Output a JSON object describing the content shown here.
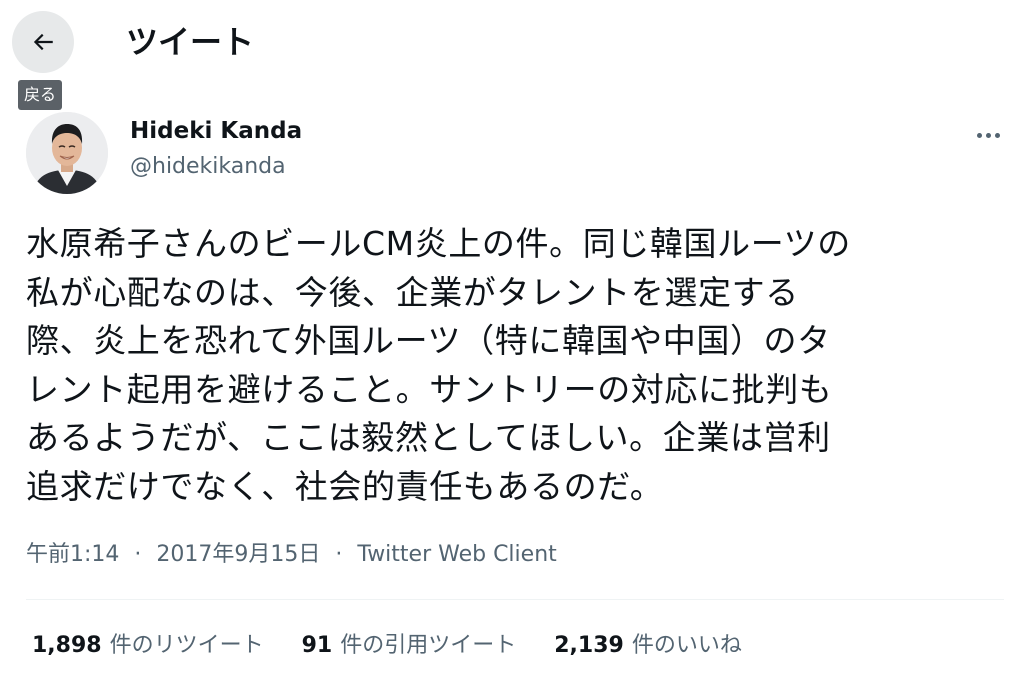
{
  "header": {
    "back_tooltip": "戻る",
    "title": "ツイート"
  },
  "author": {
    "name": "Hideki Kanda",
    "handle": "@hidekikanda"
  },
  "tweet": {
    "lines": [
      "水原希子さんのビールCM炎上の件。同じ韓国ルーツの",
      "私が心配なのは、今後、企業がタレントを選定する",
      "際、炎上を恐れて外国ルーツ（特に韓国や中国）のタ",
      "レント起用を避けること。サントリーの対応に批判も",
      "あるようだが、ここは毅然としてほしい。企業は営利",
      "追求だけでなく、社会的責任もあるのだ。"
    ]
  },
  "meta": {
    "time": "午前1:14",
    "date": "2017年9月15日",
    "separator": "·",
    "source": "Twitter Web Client"
  },
  "stats": {
    "retweets": {
      "count": "1,898",
      "label": "件のリツイート"
    },
    "quotes": {
      "count": "91",
      "label": "件の引用ツイート"
    },
    "likes": {
      "count": "2,139",
      "label": "件のいいね"
    }
  },
  "icons": {
    "back": "arrow-left-icon",
    "more": "more-horizontal-icon"
  },
  "colors": {
    "text_primary": "#0f1419",
    "text_secondary": "#536471",
    "back_button_bg": "#e7e9ea",
    "tooltip_bg": "#5b6167",
    "divider": "#eff3f4"
  }
}
